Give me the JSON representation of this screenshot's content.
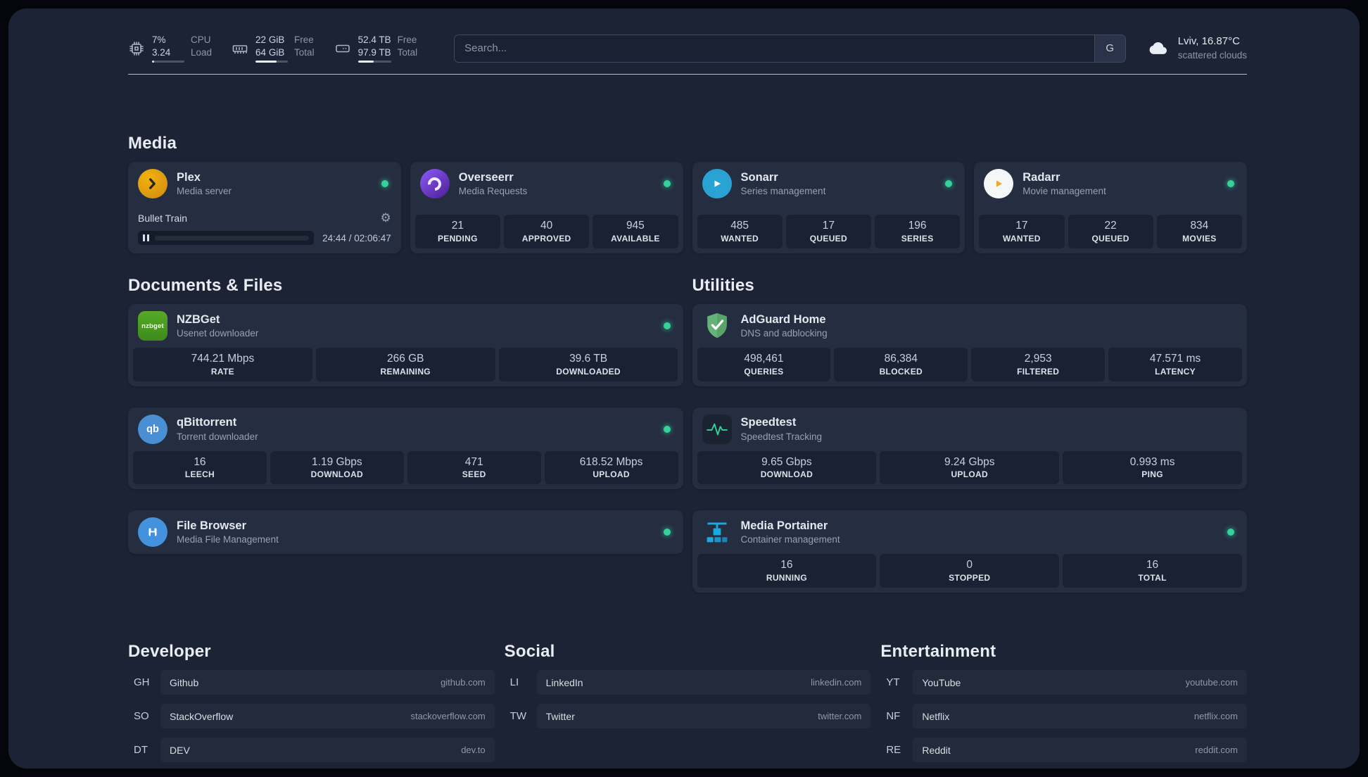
{
  "colors": {
    "status_online": "#34d399",
    "background": "#1c2334",
    "card": "#252d40"
  },
  "topbar": {
    "resources": [
      {
        "icon": "cpu-icon",
        "value_top": "7%",
        "value_bottom": "3.24",
        "label_top": "CPU",
        "label_bottom": "Load",
        "bar_percent": 7
      },
      {
        "icon": "memory-icon",
        "value_top": "22 GiB",
        "value_bottom": "64 GiB",
        "label_top": "Free",
        "label_bottom": "Total",
        "bar_percent": 66
      },
      {
        "icon": "disk-icon",
        "value_top": "52.4 TB",
        "value_bottom": "97.9 TB",
        "label_top": "Free",
        "label_bottom": "Total",
        "bar_percent": 47
      }
    ],
    "search": {
      "placeholder": "Search...",
      "provider_button": "G"
    },
    "weather": {
      "location": "Lviv, 16.87°C",
      "condition": "scattered clouds"
    }
  },
  "sections": {
    "media": {
      "title": "Media",
      "services": [
        {
          "name": "Plex",
          "subtitle": "Media server",
          "icon": "plex",
          "online": true,
          "player": {
            "title": "Bullet Train",
            "time_display": "24:44 / 02:06:47",
            "progress_percent": 19.5
          }
        },
        {
          "name": "Overseerr",
          "subtitle": "Media Requests",
          "icon": "overseerr",
          "online": true,
          "stats": [
            {
              "value": "21",
              "label": "PENDING"
            },
            {
              "value": "40",
              "label": "APPROVED"
            },
            {
              "value": "945",
              "label": "AVAILABLE"
            }
          ]
        },
        {
          "name": "Sonarr",
          "subtitle": "Series management",
          "icon": "sonarr",
          "online": true,
          "stats": [
            {
              "value": "485",
              "label": "WANTED"
            },
            {
              "value": "17",
              "label": "QUEUED"
            },
            {
              "value": "196",
              "label": "SERIES"
            }
          ]
        },
        {
          "name": "Radarr",
          "subtitle": "Movie management",
          "icon": "radarr",
          "online": true,
          "stats": [
            {
              "value": "17",
              "label": "WANTED"
            },
            {
              "value": "22",
              "label": "QUEUED"
            },
            {
              "value": "834",
              "label": "MOVIES"
            }
          ]
        }
      ]
    },
    "documents": {
      "title": "Documents & Files",
      "services": [
        {
          "name": "NZBGet",
          "subtitle": "Usenet downloader",
          "icon": "nzbget",
          "icon_text": "nzbget",
          "online": true,
          "stats": [
            {
              "value": "744.21 Mbps",
              "label": "RATE"
            },
            {
              "value": "266 GB",
              "label": "REMAINING"
            },
            {
              "value": "39.6 TB",
              "label": "DOWNLOADED"
            }
          ]
        },
        {
          "name": "qBittorrent",
          "subtitle": "Torrent downloader",
          "icon": "qbittorrent",
          "icon_text": "qb",
          "online": true,
          "stats": [
            {
              "value": "16",
              "label": "LEECH"
            },
            {
              "value": "1.19 Gbps",
              "label": "DOWNLOAD"
            },
            {
              "value": "471",
              "label": "SEED"
            },
            {
              "value": "618.52 Mbps",
              "label": "UPLOAD"
            }
          ]
        },
        {
          "name": "File Browser",
          "subtitle": "Media File Management",
          "icon": "filebrowser",
          "online": true,
          "stats": []
        }
      ]
    },
    "utilities": {
      "title": "Utilities",
      "services": [
        {
          "name": "AdGuard Home",
          "subtitle": "DNS and adblocking",
          "icon": "adguard",
          "online": null,
          "stats": [
            {
              "value": "498,461",
              "label": "QUERIES"
            },
            {
              "value": "86,384",
              "label": "BLOCKED"
            },
            {
              "value": "2,953",
              "label": "FILTERED"
            },
            {
              "value": "47.571 ms",
              "label": "LATENCY"
            }
          ]
        },
        {
          "name": "Speedtest",
          "subtitle": "Speedtest Tracking",
          "icon": "speedtest",
          "online": null,
          "stats": [
            {
              "value": "9.65 Gbps",
              "label": "DOWNLOAD"
            },
            {
              "value": "9.24 Gbps",
              "label": "UPLOAD"
            },
            {
              "value": "0.993 ms",
              "label": "PING"
            }
          ]
        },
        {
          "name": "Media Portainer",
          "subtitle": "Container management",
          "icon": "portainer",
          "online": true,
          "stats": [
            {
              "value": "16",
              "label": "RUNNING"
            },
            {
              "value": "0",
              "label": "STOPPED"
            },
            {
              "value": "16",
              "label": "TOTAL"
            }
          ]
        }
      ]
    }
  },
  "bookmarks": [
    {
      "title": "Developer",
      "items": [
        {
          "abbr": "GH",
          "name": "Github",
          "domain": "github.com"
        },
        {
          "abbr": "SO",
          "name": "StackOverflow",
          "domain": "stackoverflow.com"
        },
        {
          "abbr": "DT",
          "name": "DEV",
          "domain": "dev.to"
        }
      ]
    },
    {
      "title": "Social",
      "items": [
        {
          "abbr": "LI",
          "name": "LinkedIn",
          "domain": "linkedin.com"
        },
        {
          "abbr": "TW",
          "name": "Twitter",
          "domain": "twitter.com"
        }
      ]
    },
    {
      "title": "Entertainment",
      "items": [
        {
          "abbr": "YT",
          "name": "YouTube",
          "domain": "youtube.com"
        },
        {
          "abbr": "NF",
          "name": "Netflix",
          "domain": "netflix.com"
        },
        {
          "abbr": "RE",
          "name": "Reddit",
          "domain": "reddit.com"
        }
      ]
    }
  ]
}
